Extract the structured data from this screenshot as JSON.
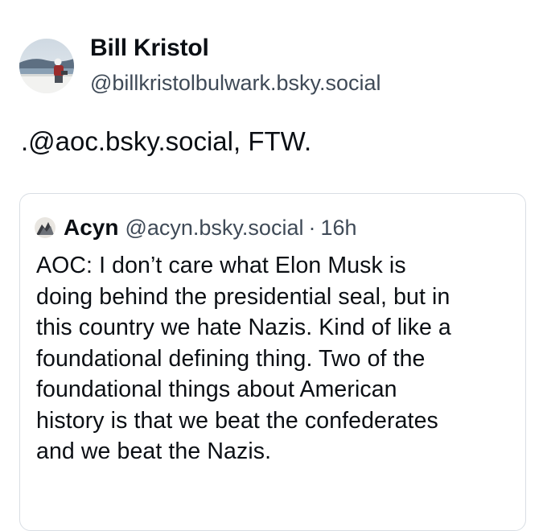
{
  "post": {
    "author": {
      "display_name": "Bill Kristol",
      "handle": "@billkristolbulwark.bsky.social"
    },
    "text": ".@aoc.bsky.social, FTW."
  },
  "quote": {
    "author": {
      "display_name": "Acyn",
      "handle": "@acyn.bsky.social"
    },
    "separator": "·",
    "time": "16h",
    "text_lines": [
      "AOC: I don’t care what Elon Musk is",
      "doing behind the presidential seal, but in",
      "this country we hate Nazis. Kind of like a",
      "foundational defining thing. Two of the",
      "foundational things about American",
      "history is that we beat the confederates",
      "and we beat the Nazis."
    ]
  },
  "icons": {
    "author_avatar": "profile-photo-avatar",
    "quote_avatar": "profile-photo-avatar"
  }
}
